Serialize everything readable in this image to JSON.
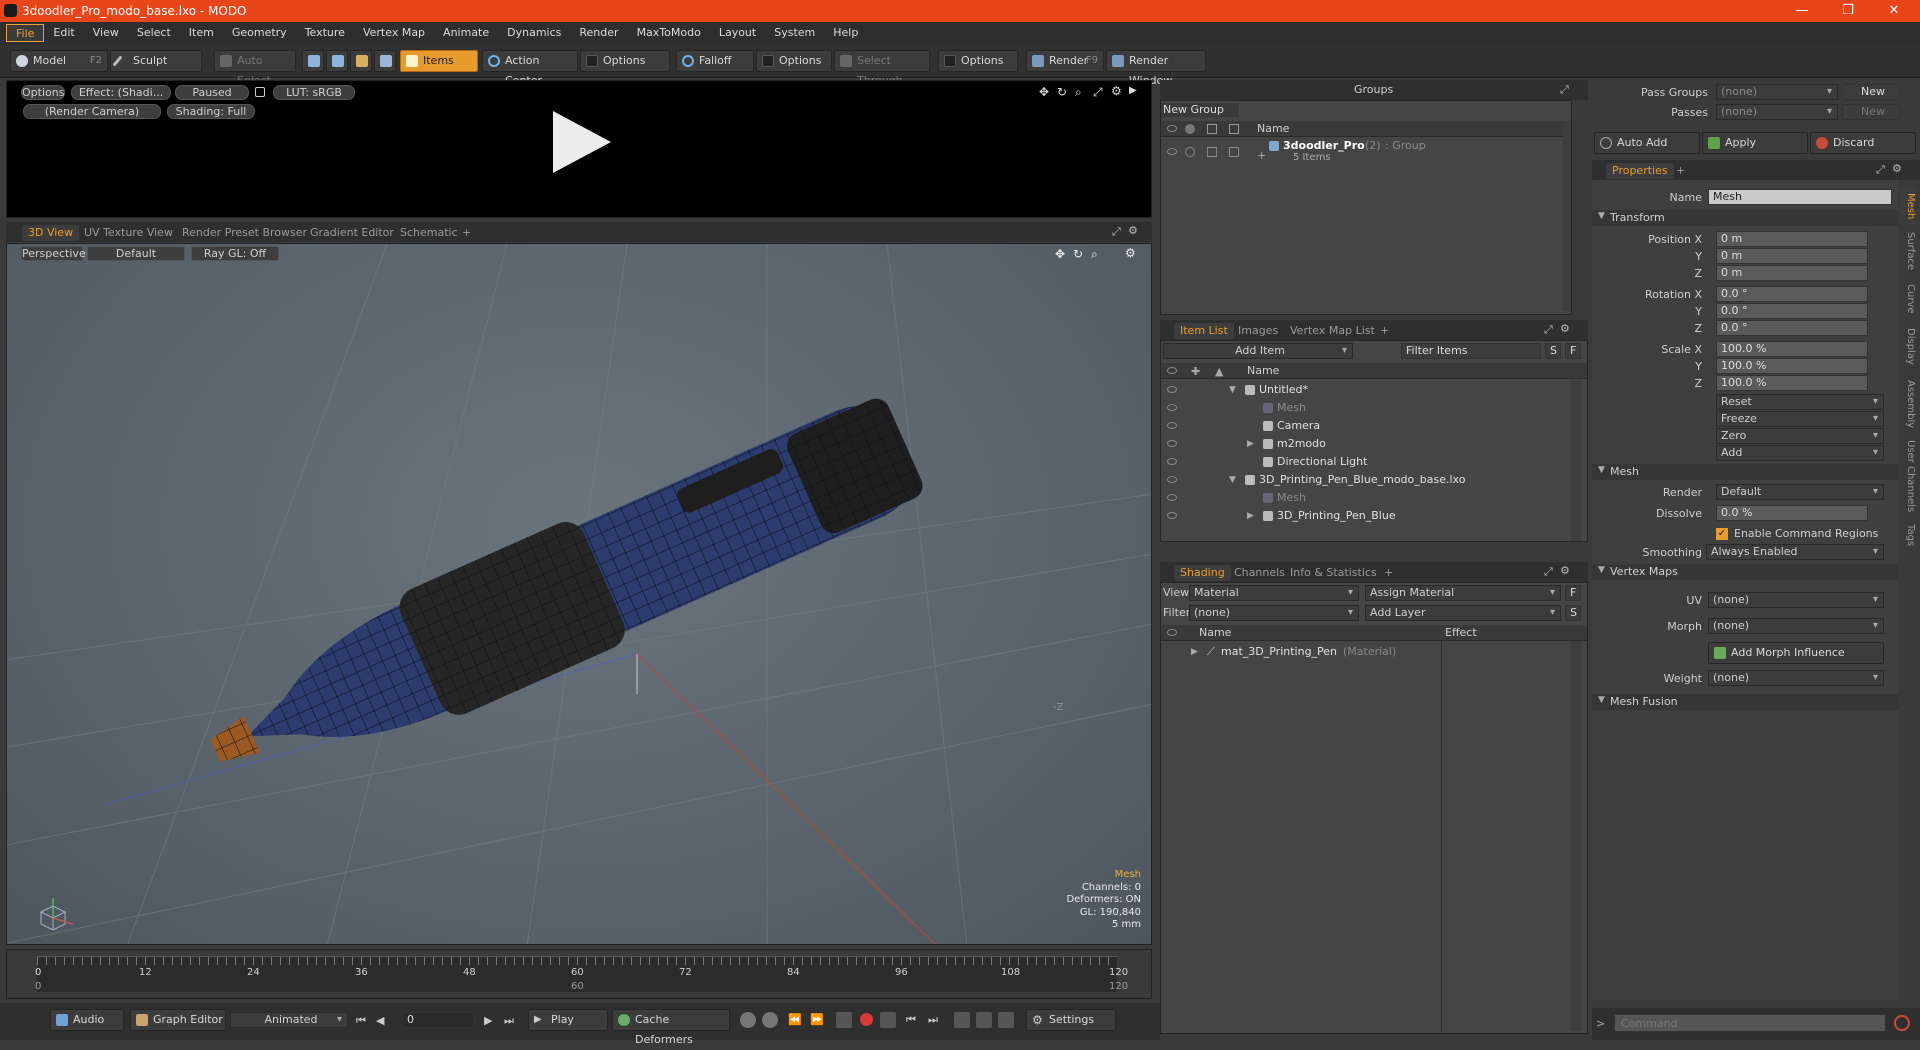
{
  "window": {
    "title": "3doodler_Pro_modo_base.lxo - MODO",
    "controls": [
      "—",
      "❐",
      "✕"
    ]
  },
  "menu": [
    "File",
    "Edit",
    "View",
    "Select",
    "Item",
    "Geometry",
    "Texture",
    "Vertex Map",
    "Animate",
    "Dynamics",
    "Render",
    "MaxToModo",
    "Layout",
    "System",
    "Help"
  ],
  "toolbar": {
    "model": "Model",
    "model_key": "F2",
    "sculpt": "Sculpt",
    "auto_select": "Auto Select",
    "items": "Items",
    "action_center": "Action Center",
    "options1": "Options",
    "falloff": "Falloff",
    "options2": "Options",
    "select_through": "Select Through",
    "options3": "Options",
    "render": "Render",
    "render_key": "F9",
    "render_window": "Render Window"
  },
  "preview": {
    "options": "Options",
    "effect": "Effect: (Shadi...",
    "paused": "Paused",
    "lut": "LUT: sRGB",
    "camera": "(Render Camera)",
    "shading": "Shading: Full"
  },
  "viewport_tabs": [
    "3D View",
    "UV Texture View",
    "Render Preset Browser",
    "Gradient Editor",
    "Schematic",
    "+"
  ],
  "viewport": {
    "perspective": "Perspective",
    "default": "Default",
    "raygl": "Ray GL: Off",
    "info_title": "Mesh",
    "channels": "Channels: 0",
    "deformers": "Deformers: ON",
    "gl": "GL: 190,840",
    "unit": "5 mm",
    "axis_label": "-Z"
  },
  "timeline": {
    "ticks": [
      "0",
      "12",
      "24",
      "36",
      "48",
      "60",
      "72",
      "84",
      "96",
      "108",
      "120"
    ],
    "sub_ticks": [
      "0",
      "60",
      "120",
      "120"
    ]
  },
  "transport": {
    "audio": "Audio",
    "graph_editor": "Graph Editor",
    "animated": "Animated",
    "frame": "0",
    "play": "Play",
    "cache": "Cache Deformers",
    "settings": "Settings"
  },
  "groups": {
    "title": "Groups",
    "new_group": "New Group",
    "col_name": "Name",
    "item_name": "3doodler_Pro",
    "item_count": "(2)",
    "item_type": ": Group",
    "item_sub": "5 Items"
  },
  "itemlist": {
    "tabs": [
      "Item List",
      "Images",
      "Vertex Map List",
      "+"
    ],
    "add_item": "Add Item",
    "filter": "Filter Items",
    "s": "S",
    "f": "F",
    "col_name": "Name",
    "rows": [
      {
        "label": "Untitled*",
        "indent": 0,
        "arrow": "▼",
        "dim": false
      },
      {
        "label": "Mesh",
        "indent": 1,
        "arrow": "",
        "dim": true
      },
      {
        "label": "Camera",
        "indent": 1,
        "arrow": "",
        "dim": false
      },
      {
        "label": "m2modo",
        "indent": 1,
        "arrow": "▶",
        "dim": false
      },
      {
        "label": "Directional Light",
        "indent": 1,
        "arrow": "",
        "dim": false
      },
      {
        "label": "3D_Printing_Pen_Blue_modo_base.lxo",
        "indent": 0,
        "arrow": "▼",
        "dim": false
      },
      {
        "label": "Mesh",
        "indent": 1,
        "arrow": "",
        "dim": true
      },
      {
        "label": "3D_Printing_Pen_Blue",
        "indent": 1,
        "arrow": "▶",
        "dim": false
      }
    ]
  },
  "shading": {
    "tabs": [
      "Shading",
      "Channels",
      "Info & Statistics",
      "+"
    ],
    "view_label": "View",
    "view_value": "Material",
    "assign": "Assign Material",
    "f": "F",
    "filter_label": "Filter",
    "filter_value": "(none)",
    "add_layer": "Add Layer",
    "s": "S",
    "col_name": "Name",
    "col_effect": "Effect",
    "row_name": "mat_3D_Printing_Pen",
    "row_type": "(Material)"
  },
  "passes": {
    "pass_groups": "Pass Groups",
    "passes": "Passes",
    "none": "(none)",
    "new": "New",
    "auto_add": "Auto Add",
    "apply": "Apply",
    "discard": "Discard"
  },
  "properties": {
    "tab": "Properties",
    "plus": "+",
    "name_label": "Name",
    "name_value": "Mesh",
    "transform": "Transform",
    "position_label": "Position X",
    "rotation_label": "Rotation X",
    "scale_label": "Scale X",
    "y": "Y",
    "z": "Z",
    "pos": [
      "0 m",
      "0 m",
      "0 m"
    ],
    "rot": [
      "0.0 °",
      "0.0 °",
      "0.0 °"
    ],
    "scale": [
      "100.0 %",
      "100.0 %",
      "100.0 %"
    ],
    "reset": "Reset",
    "freeze": "Freeze",
    "zero": "Zero",
    "add": "Add",
    "mesh_section": "Mesh",
    "render_label": "Render",
    "render_value": "Default",
    "dissolve_label": "Dissolve",
    "dissolve_value": "0.0 %",
    "enable_cmd": "Enable Command Regions",
    "smoothing_label": "Smoothing",
    "smoothing_value": "Always Enabled",
    "vertex_maps": "Vertex Maps",
    "uv_label": "UV",
    "uv_value": "(none)",
    "morph_label": "Morph",
    "morph_value": "(none)",
    "add_morph": "Add Morph Influence",
    "weight_label": "Weight",
    "weight_value": "(none)",
    "mesh_fusion": "Mesh Fusion",
    "vtabs": [
      "Mesh",
      "Surface",
      "Curve",
      "Display",
      "Assembly",
      "User Channels",
      "Tags"
    ]
  },
  "command": {
    "placeholder": "Command"
  }
}
